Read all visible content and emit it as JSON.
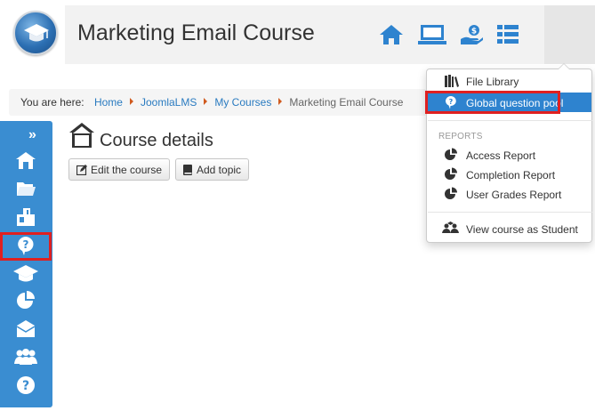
{
  "header": {
    "title": "Marketing Email Course",
    "icons": [
      "home-icon",
      "laptop-icon",
      "hand-coin-icon",
      "menu-list-icon"
    ]
  },
  "breadcrumb": {
    "prefix": "You are here:",
    "items": [
      "Home",
      "JoomlaLMS",
      "My Courses"
    ],
    "current": "Marketing Email Course"
  },
  "sidebar": {
    "collapse": "»",
    "icons": [
      "home-icon",
      "folder-icon",
      "puzzle-icon",
      "question-bubble-icon",
      "graduation-cap-icon",
      "pie-chart-icon",
      "mail-icon",
      "users-icon",
      "help-icon"
    ]
  },
  "main": {
    "title": "Course details",
    "edit_button": "Edit the course",
    "add_topic_button": "Add topic"
  },
  "dropdown": {
    "file_library": "File Library",
    "global_question_pool": "Global question pool",
    "reports_header": "REPORTS",
    "access_report": "Access Report",
    "completion_report": "Completion Report",
    "user_grades_report": "User Grades Report",
    "view_as_student": "View course as Student"
  },
  "colors": {
    "accent": "#2e83cf",
    "sidebar": "#3a8dd1",
    "highlight": "#e02020",
    "link": "#2a7bc0"
  }
}
